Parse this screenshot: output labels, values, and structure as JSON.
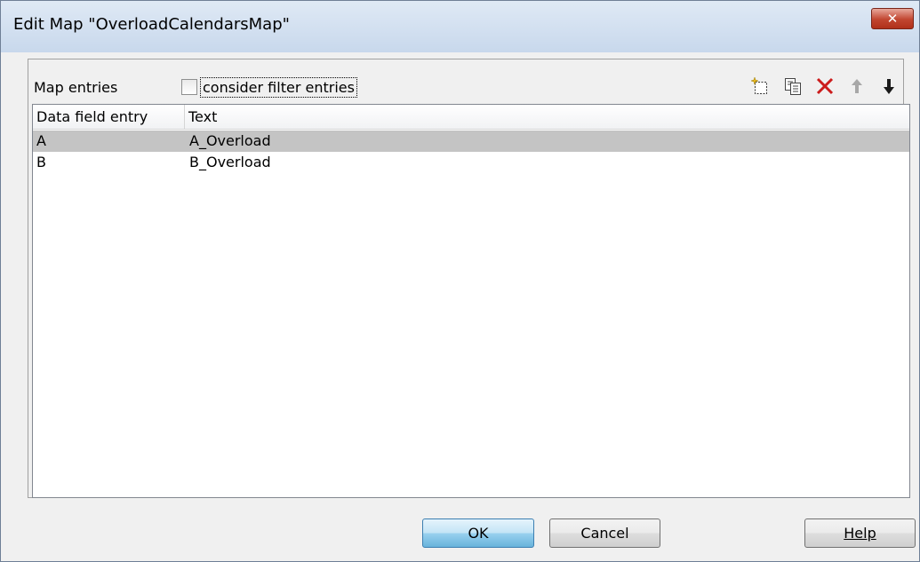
{
  "window": {
    "title": "Edit Map \"OverloadCalendarsMap\"",
    "close_glyph": "✕"
  },
  "map": {
    "label": "Map entries",
    "consider_filter_label": "consider filter entries",
    "consider_filter_checked": false
  },
  "toolbar": {
    "icons": [
      "new-entry-icon",
      "copy-icon",
      "delete-icon",
      "move-up-icon",
      "move-down-icon"
    ],
    "delete_color": "#cc1c1c",
    "arrow_up_color": "#a8a8a8",
    "arrow_down_color": "#1a1a1a"
  },
  "table": {
    "columns": [
      "Data field entry",
      "Text"
    ],
    "rows": [
      {
        "key": "A",
        "text": "A_Overload",
        "selected": true
      },
      {
        "key": "B",
        "text": "B_Overload",
        "selected": false
      }
    ]
  },
  "buttons": {
    "ok": "OK",
    "cancel": "Cancel",
    "help": "Help"
  }
}
